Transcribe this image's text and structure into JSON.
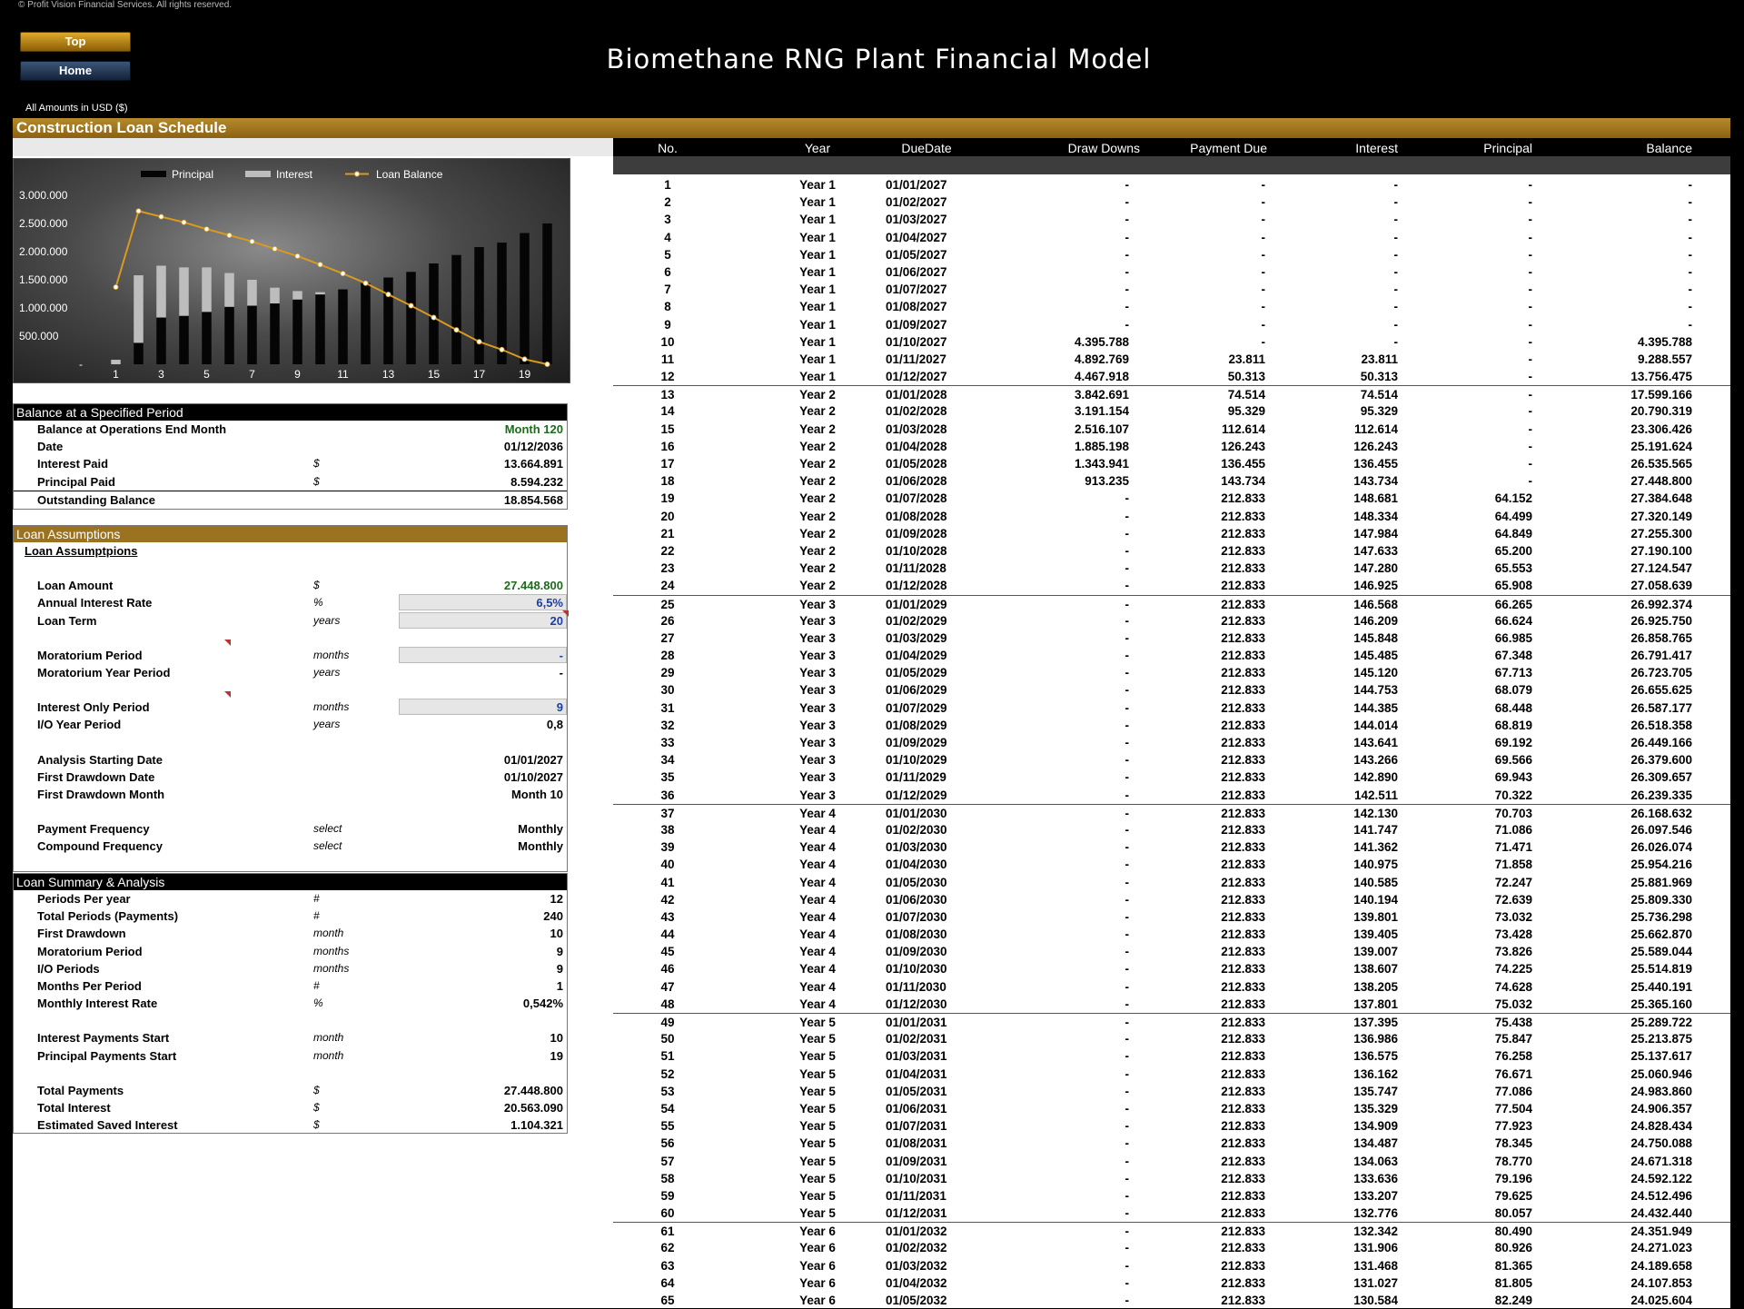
{
  "copyright": "© Profit Vision Financial Services. All rights reserved.",
  "nav": {
    "top_label": "Top",
    "home_label": "Home"
  },
  "title": "Biomethane RNG Plant Financial Model",
  "amounts_note": "All Amounts in  USD ($)",
  "section_title": "Construction Loan Schedule",
  "chart_data": {
    "type": "bar",
    "legend": [
      "Principal",
      "Interest",
      "Loan Balance"
    ],
    "legend_position": "top",
    "x_ticks": [
      "1",
      "3",
      "5",
      "7",
      "9",
      "11",
      "13",
      "15",
      "17",
      "19"
    ],
    "y_ticks": [
      "3.000.000",
      "2.500.000",
      "2.000.000",
      "1.500.000",
      "1.000.000",
      "500.000",
      "-"
    ],
    "ylim": [
      0,
      3000000
    ],
    "categories": [
      1,
      2,
      3,
      4,
      5,
      6,
      7,
      8,
      9,
      10,
      11,
      12,
      13,
      14,
      15,
      16,
      17,
      18,
      19,
      20
    ],
    "series": [
      {
        "name": "Principal",
        "type": "bar",
        "values": [
          0,
          380000,
          830000,
          860000,
          930000,
          1020000,
          1040000,
          1080000,
          1150000,
          1240000,
          1330000,
          1440000,
          1540000,
          1640000,
          1790000,
          1940000,
          2080000,
          2160000,
          2330000,
          2500000
        ]
      },
      {
        "name": "Interest",
        "type": "bar",
        "values": [
          80000,
          1200000,
          920000,
          860000,
          790000,
          600000,
          460000,
          280000,
          150000,
          40000,
          0,
          0,
          0,
          0,
          0,
          0,
          0,
          0,
          0,
          0
        ]
      },
      {
        "name": "Loan Balance",
        "type": "line",
        "values": [
          1370000,
          2720000,
          2620000,
          2520000,
          2400000,
          2290000,
          2180000,
          2050000,
          1920000,
          1770000,
          1610000,
          1440000,
          1240000,
          1040000,
          830000,
          610000,
          400000,
          260000,
          90000,
          0
        ]
      }
    ]
  },
  "balance_section": {
    "header": "Balance at a Specified Period",
    "rows": [
      {
        "label": "Balance at Operations End Month",
        "unit": "",
        "value": "Month 120"
      },
      {
        "label": "Date",
        "unit": "",
        "value": "01/12/2036"
      },
      {
        "label": "Interest Paid",
        "unit": "$",
        "value": "13.664.891"
      },
      {
        "label": "Principal Paid",
        "unit": "$",
        "value": "8.594.232"
      },
      {
        "label": "Outstanding Balance",
        "unit": "",
        "value": "18.854.568"
      }
    ]
  },
  "assumptions_section": {
    "header": "Loan Assumptions",
    "subheader": "Loan Assumptpions",
    "rows": [
      {
        "label": "Loan Amount",
        "unit": "$",
        "value": "27.448.800"
      },
      {
        "label": "Annual Interest Rate",
        "unit": "%",
        "value": "6,5%"
      },
      {
        "label": "Loan Term",
        "unit": "years",
        "value": "20"
      },
      {
        "label": "Moratorium Period",
        "unit": "months",
        "value": "-"
      },
      {
        "label": "Moratorium Year Period",
        "unit": "years",
        "value": "-"
      },
      {
        "label": "Interest Only Period",
        "unit": "months",
        "value": "9"
      },
      {
        "label": "I/O Year Period",
        "unit": "years",
        "value": "0,8"
      },
      {
        "label": "Analysis Starting Date",
        "unit": "",
        "value": "01/01/2027"
      },
      {
        "label": "First Drawdown Date",
        "unit": "",
        "value": "01/10/2027"
      },
      {
        "label": "First Drawdown Month",
        "unit": "",
        "value": "Month 10"
      },
      {
        "label": "Payment Frequency",
        "unit": "select",
        "value": "Monthly"
      },
      {
        "label": "Compound Frequency",
        "unit": "select",
        "value": "Monthly"
      }
    ]
  },
  "summary_section": {
    "header": "Loan Summary & Analysis",
    "rows": [
      {
        "label": "Periods Per year",
        "unit": "#",
        "value": "12"
      },
      {
        "label": "Total Periods (Payments)",
        "unit": "#",
        "value": "240"
      },
      {
        "label": "First Drawdown",
        "unit": "month",
        "value": "10"
      },
      {
        "label": "Moratorium Period",
        "unit": "months",
        "value": "9"
      },
      {
        "label": "I/O Periods",
        "unit": "months",
        "value": "9"
      },
      {
        "label": "Months Per Period",
        "unit": "#",
        "value": "1"
      },
      {
        "label": "Monthly Interest Rate",
        "unit": "%",
        "value": "0,542%"
      },
      {
        "label": "Interest Payments Start",
        "unit": "month",
        "value": "10"
      },
      {
        "label": "Principal Payments Start",
        "unit": "month",
        "value": "19"
      },
      {
        "label": "Total Payments",
        "unit": "$",
        "value": "27.448.800"
      },
      {
        "label": "Total Interest",
        "unit": "$",
        "value": "20.563.090"
      },
      {
        "label": "Estimated Saved Interest",
        "unit": "$",
        "value": "1.104.321"
      }
    ]
  },
  "schedule": {
    "columns": [
      "No.",
      "Year",
      "DueDate",
      "Draw Downs",
      "Payment Due",
      "Interest",
      "Principal",
      "Balance"
    ],
    "rows": [
      [
        "1",
        "Year 1",
        "01/01/2027",
        "-",
        "-",
        "-",
        "-",
        "-"
      ],
      [
        "2",
        "Year 1",
        "01/02/2027",
        "-",
        "-",
        "-",
        "-",
        "-"
      ],
      [
        "3",
        "Year 1",
        "01/03/2027",
        "-",
        "-",
        "-",
        "-",
        "-"
      ],
      [
        "4",
        "Year 1",
        "01/04/2027",
        "-",
        "-",
        "-",
        "-",
        "-"
      ],
      [
        "5",
        "Year 1",
        "01/05/2027",
        "-",
        "-",
        "-",
        "-",
        "-"
      ],
      [
        "6",
        "Year 1",
        "01/06/2027",
        "-",
        "-",
        "-",
        "-",
        "-"
      ],
      [
        "7",
        "Year 1",
        "01/07/2027",
        "-",
        "-",
        "-",
        "-",
        "-"
      ],
      [
        "8",
        "Year 1",
        "01/08/2027",
        "-",
        "-",
        "-",
        "-",
        "-"
      ],
      [
        "9",
        "Year 1",
        "01/09/2027",
        "-",
        "-",
        "-",
        "-",
        "-"
      ],
      [
        "10",
        "Year 1",
        "01/10/2027",
        "4.395.788",
        "-",
        "-",
        "-",
        "4.395.788"
      ],
      [
        "11",
        "Year 1",
        "01/11/2027",
        "4.892.769",
        "23.811",
        "23.811",
        "-",
        "9.288.557"
      ],
      [
        "12",
        "Year 1",
        "01/12/2027",
        "4.467.918",
        "50.313",
        "50.313",
        "-",
        "13.756.475"
      ],
      [
        "13",
        "Year 2",
        "01/01/2028",
        "3.842.691",
        "74.514",
        "74.514",
        "-",
        "17.599.166"
      ],
      [
        "14",
        "Year 2",
        "01/02/2028",
        "3.191.154",
        "95.329",
        "95.329",
        "-",
        "20.790.319"
      ],
      [
        "15",
        "Year 2",
        "01/03/2028",
        "2.516.107",
        "112.614",
        "112.614",
        "-",
        "23.306.426"
      ],
      [
        "16",
        "Year 2",
        "01/04/2028",
        "1.885.198",
        "126.243",
        "126.243",
        "-",
        "25.191.624"
      ],
      [
        "17",
        "Year 2",
        "01/05/2028",
        "1.343.941",
        "136.455",
        "136.455",
        "-",
        "26.535.565"
      ],
      [
        "18",
        "Year 2",
        "01/06/2028",
        "913.235",
        "143.734",
        "143.734",
        "-",
        "27.448.800"
      ],
      [
        "19",
        "Year 2",
        "01/07/2028",
        "-",
        "212.833",
        "148.681",
        "64.152",
        "27.384.648"
      ],
      [
        "20",
        "Year 2",
        "01/08/2028",
        "-",
        "212.833",
        "148.334",
        "64.499",
        "27.320.149"
      ],
      [
        "21",
        "Year 2",
        "01/09/2028",
        "-",
        "212.833",
        "147.984",
        "64.849",
        "27.255.300"
      ],
      [
        "22",
        "Year 2",
        "01/10/2028",
        "-",
        "212.833",
        "147.633",
        "65.200",
        "27.190.100"
      ],
      [
        "23",
        "Year 2",
        "01/11/2028",
        "-",
        "212.833",
        "147.280",
        "65.553",
        "27.124.547"
      ],
      [
        "24",
        "Year 2",
        "01/12/2028",
        "-",
        "212.833",
        "146.925",
        "65.908",
        "27.058.639"
      ],
      [
        "25",
        "Year 3",
        "01/01/2029",
        "-",
        "212.833",
        "146.568",
        "66.265",
        "26.992.374"
      ],
      [
        "26",
        "Year 3",
        "01/02/2029",
        "-",
        "212.833",
        "146.209",
        "66.624",
        "26.925.750"
      ],
      [
        "27",
        "Year 3",
        "01/03/2029",
        "-",
        "212.833",
        "145.848",
        "66.985",
        "26.858.765"
      ],
      [
        "28",
        "Year 3",
        "01/04/2029",
        "-",
        "212.833",
        "145.485",
        "67.348",
        "26.791.417"
      ],
      [
        "29",
        "Year 3",
        "01/05/2029",
        "-",
        "212.833",
        "145.120",
        "67.713",
        "26.723.705"
      ],
      [
        "30",
        "Year 3",
        "01/06/2029",
        "-",
        "212.833",
        "144.753",
        "68.079",
        "26.655.625"
      ],
      [
        "31",
        "Year 3",
        "01/07/2029",
        "-",
        "212.833",
        "144.385",
        "68.448",
        "26.587.177"
      ],
      [
        "32",
        "Year 3",
        "01/08/2029",
        "-",
        "212.833",
        "144.014",
        "68.819",
        "26.518.358"
      ],
      [
        "33",
        "Year 3",
        "01/09/2029",
        "-",
        "212.833",
        "143.641",
        "69.192",
        "26.449.166"
      ],
      [
        "34",
        "Year 3",
        "01/10/2029",
        "-",
        "212.833",
        "143.266",
        "69.566",
        "26.379.600"
      ],
      [
        "35",
        "Year 3",
        "01/11/2029",
        "-",
        "212.833",
        "142.890",
        "69.943",
        "26.309.657"
      ],
      [
        "36",
        "Year 3",
        "01/12/2029",
        "-",
        "212.833",
        "142.511",
        "70.322",
        "26.239.335"
      ],
      [
        "37",
        "Year 4",
        "01/01/2030",
        "-",
        "212.833",
        "142.130",
        "70.703",
        "26.168.632"
      ],
      [
        "38",
        "Year 4",
        "01/02/2030",
        "-",
        "212.833",
        "141.747",
        "71.086",
        "26.097.546"
      ],
      [
        "39",
        "Year 4",
        "01/03/2030",
        "-",
        "212.833",
        "141.362",
        "71.471",
        "26.026.074"
      ],
      [
        "40",
        "Year 4",
        "01/04/2030",
        "-",
        "212.833",
        "140.975",
        "71.858",
        "25.954.216"
      ],
      [
        "41",
        "Year 4",
        "01/05/2030",
        "-",
        "212.833",
        "140.585",
        "72.247",
        "25.881.969"
      ],
      [
        "42",
        "Year 4",
        "01/06/2030",
        "-",
        "212.833",
        "140.194",
        "72.639",
        "25.809.330"
      ],
      [
        "43",
        "Year 4",
        "01/07/2030",
        "-",
        "212.833",
        "139.801",
        "73.032",
        "25.736.298"
      ],
      [
        "44",
        "Year 4",
        "01/08/2030",
        "-",
        "212.833",
        "139.405",
        "73.428",
        "25.662.870"
      ],
      [
        "45",
        "Year 4",
        "01/09/2030",
        "-",
        "212.833",
        "139.007",
        "73.826",
        "25.589.044"
      ],
      [
        "46",
        "Year 4",
        "01/10/2030",
        "-",
        "212.833",
        "138.607",
        "74.225",
        "25.514.819"
      ],
      [
        "47",
        "Year 4",
        "01/11/2030",
        "-",
        "212.833",
        "138.205",
        "74.628",
        "25.440.191"
      ],
      [
        "48",
        "Year 4",
        "01/12/2030",
        "-",
        "212.833",
        "137.801",
        "75.032",
        "25.365.160"
      ],
      [
        "49",
        "Year 5",
        "01/01/2031",
        "-",
        "212.833",
        "137.395",
        "75.438",
        "25.289.722"
      ],
      [
        "50",
        "Year 5",
        "01/02/2031",
        "-",
        "212.833",
        "136.986",
        "75.847",
        "25.213.875"
      ],
      [
        "51",
        "Year 5",
        "01/03/2031",
        "-",
        "212.833",
        "136.575",
        "76.258",
        "25.137.617"
      ],
      [
        "52",
        "Year 5",
        "01/04/2031",
        "-",
        "212.833",
        "136.162",
        "76.671",
        "25.060.946"
      ],
      [
        "53",
        "Year 5",
        "01/05/2031",
        "-",
        "212.833",
        "135.747",
        "77.086",
        "24.983.860"
      ],
      [
        "54",
        "Year 5",
        "01/06/2031",
        "-",
        "212.833",
        "135.329",
        "77.504",
        "24.906.357"
      ],
      [
        "55",
        "Year 5",
        "01/07/2031",
        "-",
        "212.833",
        "134.909",
        "77.923",
        "24.828.434"
      ],
      [
        "56",
        "Year 5",
        "01/08/2031",
        "-",
        "212.833",
        "134.487",
        "78.345",
        "24.750.088"
      ],
      [
        "57",
        "Year 5",
        "01/09/2031",
        "-",
        "212.833",
        "134.063",
        "78.770",
        "24.671.318"
      ],
      [
        "58",
        "Year 5",
        "01/10/2031",
        "-",
        "212.833",
        "133.636",
        "79.196",
        "24.592.122"
      ],
      [
        "59",
        "Year 5",
        "01/11/2031",
        "-",
        "212.833",
        "133.207",
        "79.625",
        "24.512.496"
      ],
      [
        "60",
        "Year 5",
        "01/12/2031",
        "-",
        "212.833",
        "132.776",
        "80.057",
        "24.432.440"
      ],
      [
        "61",
        "Year 6",
        "01/01/2032",
        "-",
        "212.833",
        "132.342",
        "80.490",
        "24.351.949"
      ],
      [
        "62",
        "Year 6",
        "01/02/2032",
        "-",
        "212.833",
        "131.906",
        "80.926",
        "24.271.023"
      ],
      [
        "63",
        "Year 6",
        "01/03/2032",
        "-",
        "212.833",
        "131.468",
        "81.365",
        "24.189.658"
      ],
      [
        "64",
        "Year 6",
        "01/04/2032",
        "-",
        "212.833",
        "131.027",
        "81.805",
        "24.107.853"
      ],
      [
        "65",
        "Year 6",
        "01/05/2032",
        "-",
        "212.833",
        "130.584",
        "82.249",
        "24.025.604"
      ]
    ]
  }
}
